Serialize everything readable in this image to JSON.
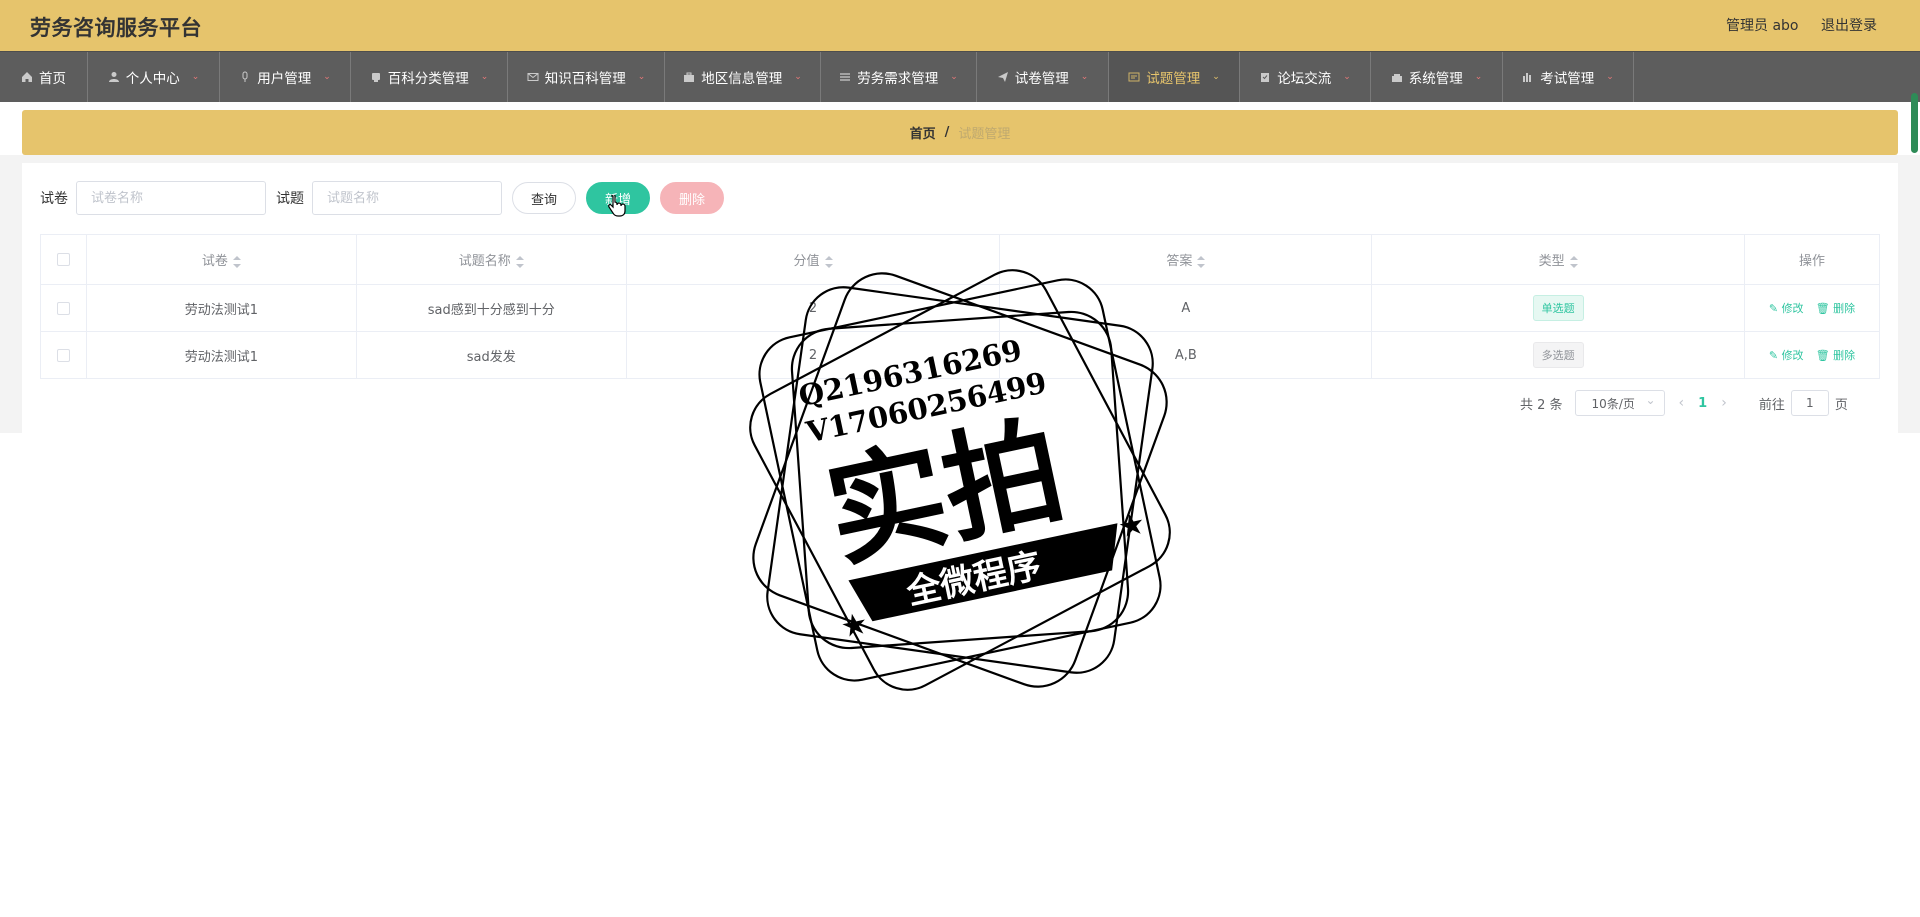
{
  "app": {
    "title": "劳务咨询服务平台",
    "admin_label": "管理员 abo",
    "logout": "退出登录"
  },
  "nav": [
    {
      "label": "首页",
      "icon": "home-icon",
      "w": 88
    },
    {
      "label": "个人中心",
      "icon": "user-icon",
      "w": 132
    },
    {
      "label": "用户管理",
      "icon": "mic-icon",
      "w": 131
    },
    {
      "label": "百科分类管理",
      "icon": "tablet-icon",
      "w": 157
    },
    {
      "label": "知识百科管理",
      "icon": "mail-icon",
      "w": 157
    },
    {
      "label": "地区信息管理",
      "icon": "briefcase-icon",
      "w": 156
    },
    {
      "label": "劳务需求管理",
      "icon": "list-icon",
      "w": 156
    },
    {
      "label": "试卷管理",
      "icon": "send-icon",
      "w": 132
    },
    {
      "label": "试题管理",
      "icon": "ticket-icon",
      "w": 131
    },
    {
      "label": "论坛交流",
      "icon": "clipboard-icon",
      "w": 131
    },
    {
      "label": "系统管理",
      "icon": "toolbox-icon",
      "w": 132
    },
    {
      "label": "考试管理",
      "icon": "chart-icon",
      "w": 131
    }
  ],
  "breadcrumb": {
    "home": "首页",
    "sep": "/",
    "current": "试题管理"
  },
  "search": {
    "paper_label": "试卷",
    "paper_placeholder": "试卷名称",
    "question_label": "试题",
    "question_placeholder": "试题名称",
    "query": "查询",
    "add": "新增",
    "delete": "删除"
  },
  "table": {
    "headers": [
      "试卷",
      "试题名称",
      "分值",
      "答案",
      "类型",
      "操作"
    ],
    "rows": [
      {
        "paper": "劳动法测试1",
        "name": "sad感到十分感到十分",
        "score": "2",
        "answer": "A",
        "type": "单选题"
      },
      {
        "paper": "劳动法测试1",
        "name": "sad发发",
        "score": "2",
        "answer": "A,B",
        "type": "多选题"
      }
    ],
    "edit": "修改",
    "del": "删除"
  },
  "pager": {
    "total": "共 2 条",
    "size": "10条/页",
    "current": "1",
    "goto": "前往",
    "page_value": "1",
    "page_unit": "页"
  },
  "watermark": {
    "line1": "Q2196316269",
    "line2": "V17060256499",
    "big": "实拍",
    "banner": "全微程序"
  },
  "colors": {
    "topbar": "#e6c46c",
    "nav": "#5d5d5d",
    "accent": "#2fc5a0",
    "danger_light": "#f6b4b8"
  }
}
